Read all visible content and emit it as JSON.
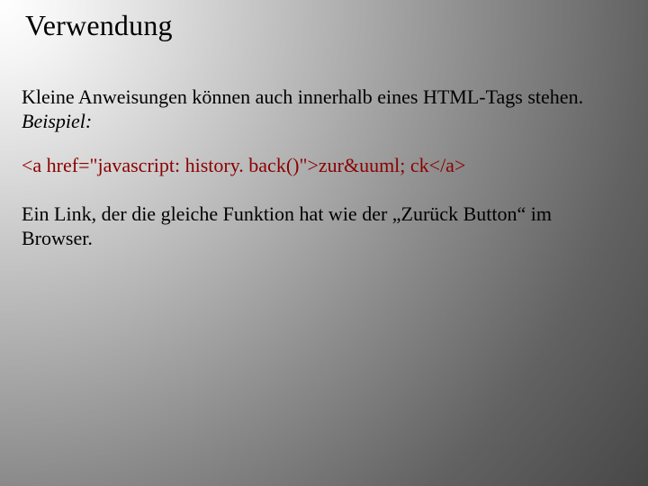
{
  "title": "Verwendung",
  "para1_a": "Kleine Anweisungen können auch innerhalb eines  HTML-Tags stehen. ",
  "para1_b": "Beispiel:",
  "code_line": "<a href=\"javascript: history. back()\">zur&uuml; ck</a>",
  "para2": "Ein Link, der die gleiche Funktion hat wie der „Zurück Button“ im Browser."
}
